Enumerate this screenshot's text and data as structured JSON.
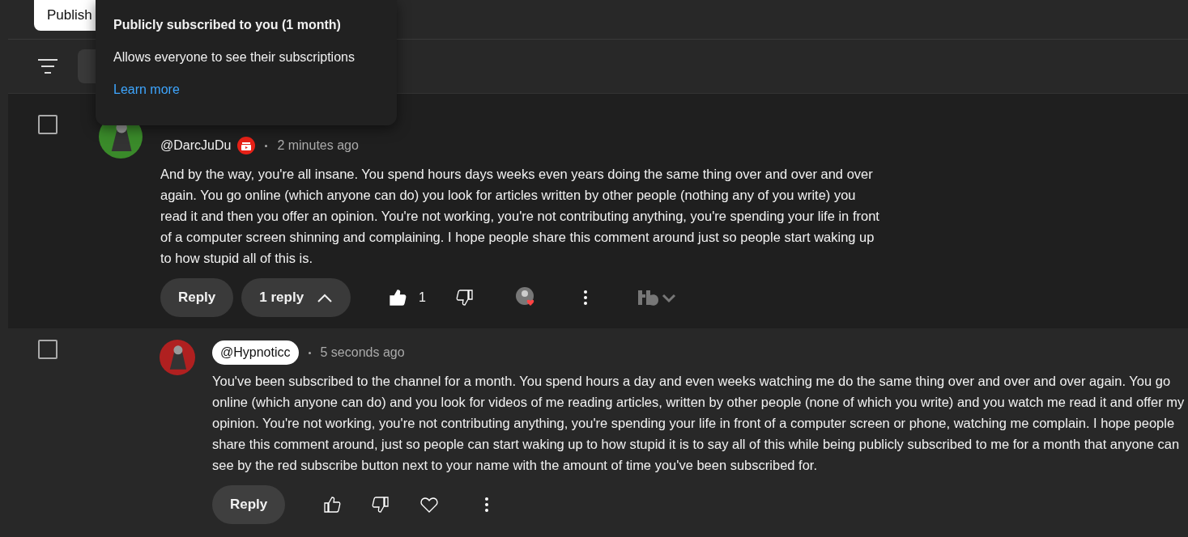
{
  "top_tab": {
    "label": "Publish"
  },
  "tooltip": {
    "title": "Publicly subscribed to you (1 month)",
    "body": "Allows everyone to see their subscriptions",
    "link": "Learn more"
  },
  "comments": [
    {
      "author": "@DarcJuDu",
      "highlighted": false,
      "subscriber_badge": true,
      "time": "2 minutes ago",
      "text": "And by the way, you're all insane. You spend hours days weeks even years doing the same thing over and over and over again. You go online (which anyone can do) you look for articles written by other people (nothing any of you write) you read it and then you offer an opinion. You're not working, you're not contributing anything, you're spending your life in front of a computer screen shinning and complaining. I hope people share this comment around just so people start waking up to how stupid all of this is.",
      "reply_label": "Reply",
      "replies_label": "1 reply",
      "expanded": true,
      "liked": true,
      "like_count": "1",
      "hearted": true,
      "checked": false,
      "kind": "top",
      "children": [
        {
          "author": "@Hypnoticc",
          "highlighted": true,
          "time": "5 seconds ago",
          "text": "You've been subscribed to the channel for a month. You spend hours a day and even weeks watching me do the same thing over and over and over again. You go online (which anyone can do) and you look for videos of me reading articles, written by other people (none of which you write) and you watch me read it and offer my opinion. You're not working, you're not contributing anything, you're spending your life in front of a computer screen or phone, watching me complain. I hope people share this comment around, just so people can start waking up to how stupid it is to say all of this while being publicly subscribed to me for a month that anyone can see by the red subscribe button next to your name with the amount of time you've been subscribed for.",
          "reply_label": "Reply",
          "liked": false,
          "hearted": false,
          "checked": false,
          "kind": "reply"
        }
      ]
    }
  ]
}
